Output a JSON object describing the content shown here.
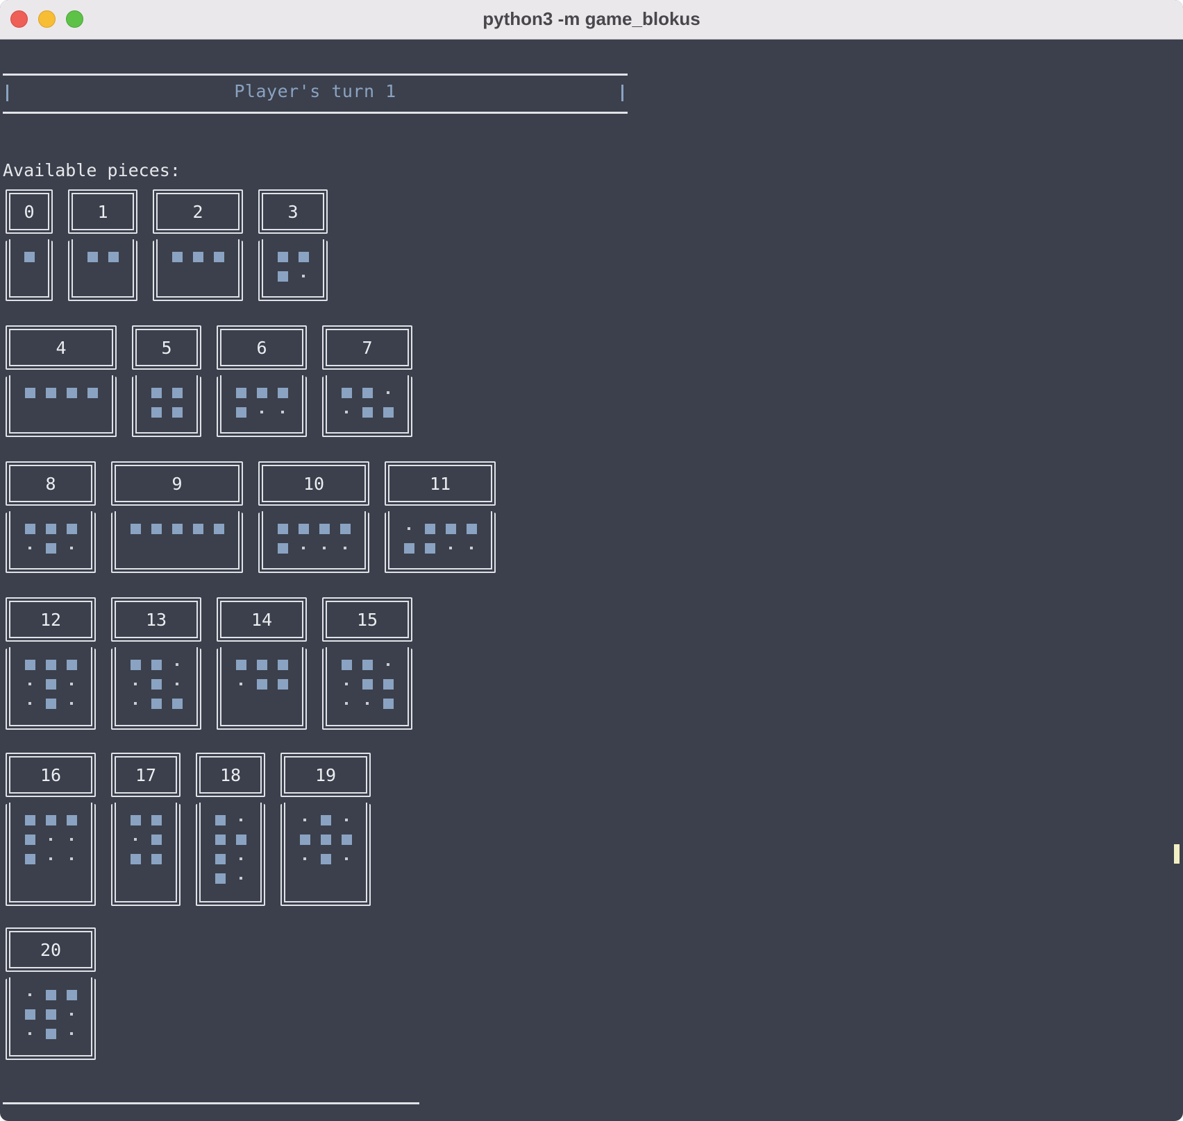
{
  "window": {
    "title": "python3 -m game_blokus",
    "colors": {
      "background": "#3b404c",
      "piece_cell": "#8ba3c2",
      "empty_cell": "#c9ccd2",
      "frame": "#e1e3e8",
      "turn_text": "#8ba3c2"
    }
  },
  "header": {
    "turn_label": "Player's turn 1"
  },
  "pieces_section": {
    "label": "Available pieces:",
    "pieces": [
      {
        "id": "0",
        "shape": [
          "#"
        ]
      },
      {
        "id": "1",
        "shape": [
          "##"
        ]
      },
      {
        "id": "2",
        "shape": [
          "###"
        ]
      },
      {
        "id": "3",
        "shape": [
          "##",
          "#."
        ]
      },
      {
        "id": "4",
        "shape": [
          "####"
        ]
      },
      {
        "id": "5",
        "shape": [
          "##",
          "##"
        ]
      },
      {
        "id": "6",
        "shape": [
          "###",
          "#.."
        ]
      },
      {
        "id": "7",
        "shape": [
          "##.",
          ".##"
        ]
      },
      {
        "id": "8",
        "shape": [
          "###",
          ".#."
        ]
      },
      {
        "id": "9",
        "shape": [
          "#####"
        ]
      },
      {
        "id": "10",
        "shape": [
          "####",
          "#..."
        ]
      },
      {
        "id": "11",
        "shape": [
          ".###",
          "##.."
        ]
      },
      {
        "id": "12",
        "shape": [
          "###",
          ".#.",
          ".#."
        ]
      },
      {
        "id": "13",
        "shape": [
          "##.",
          ".#.",
          ".##"
        ]
      },
      {
        "id": "14",
        "shape": [
          "###",
          ".##"
        ]
      },
      {
        "id": "15",
        "shape": [
          "##.",
          ".##",
          "..#"
        ]
      },
      {
        "id": "16",
        "shape": [
          "###",
          "#..",
          "#.."
        ]
      },
      {
        "id": "17",
        "shape": [
          "##",
          ".#",
          "##"
        ]
      },
      {
        "id": "18",
        "shape": [
          "#.",
          "##",
          "#.",
          "#."
        ]
      },
      {
        "id": "19",
        "shape": [
          ".#.",
          "###",
          ".#."
        ]
      },
      {
        "id": "20",
        "shape": [
          ".##",
          "##.",
          ".#."
        ]
      }
    ]
  }
}
